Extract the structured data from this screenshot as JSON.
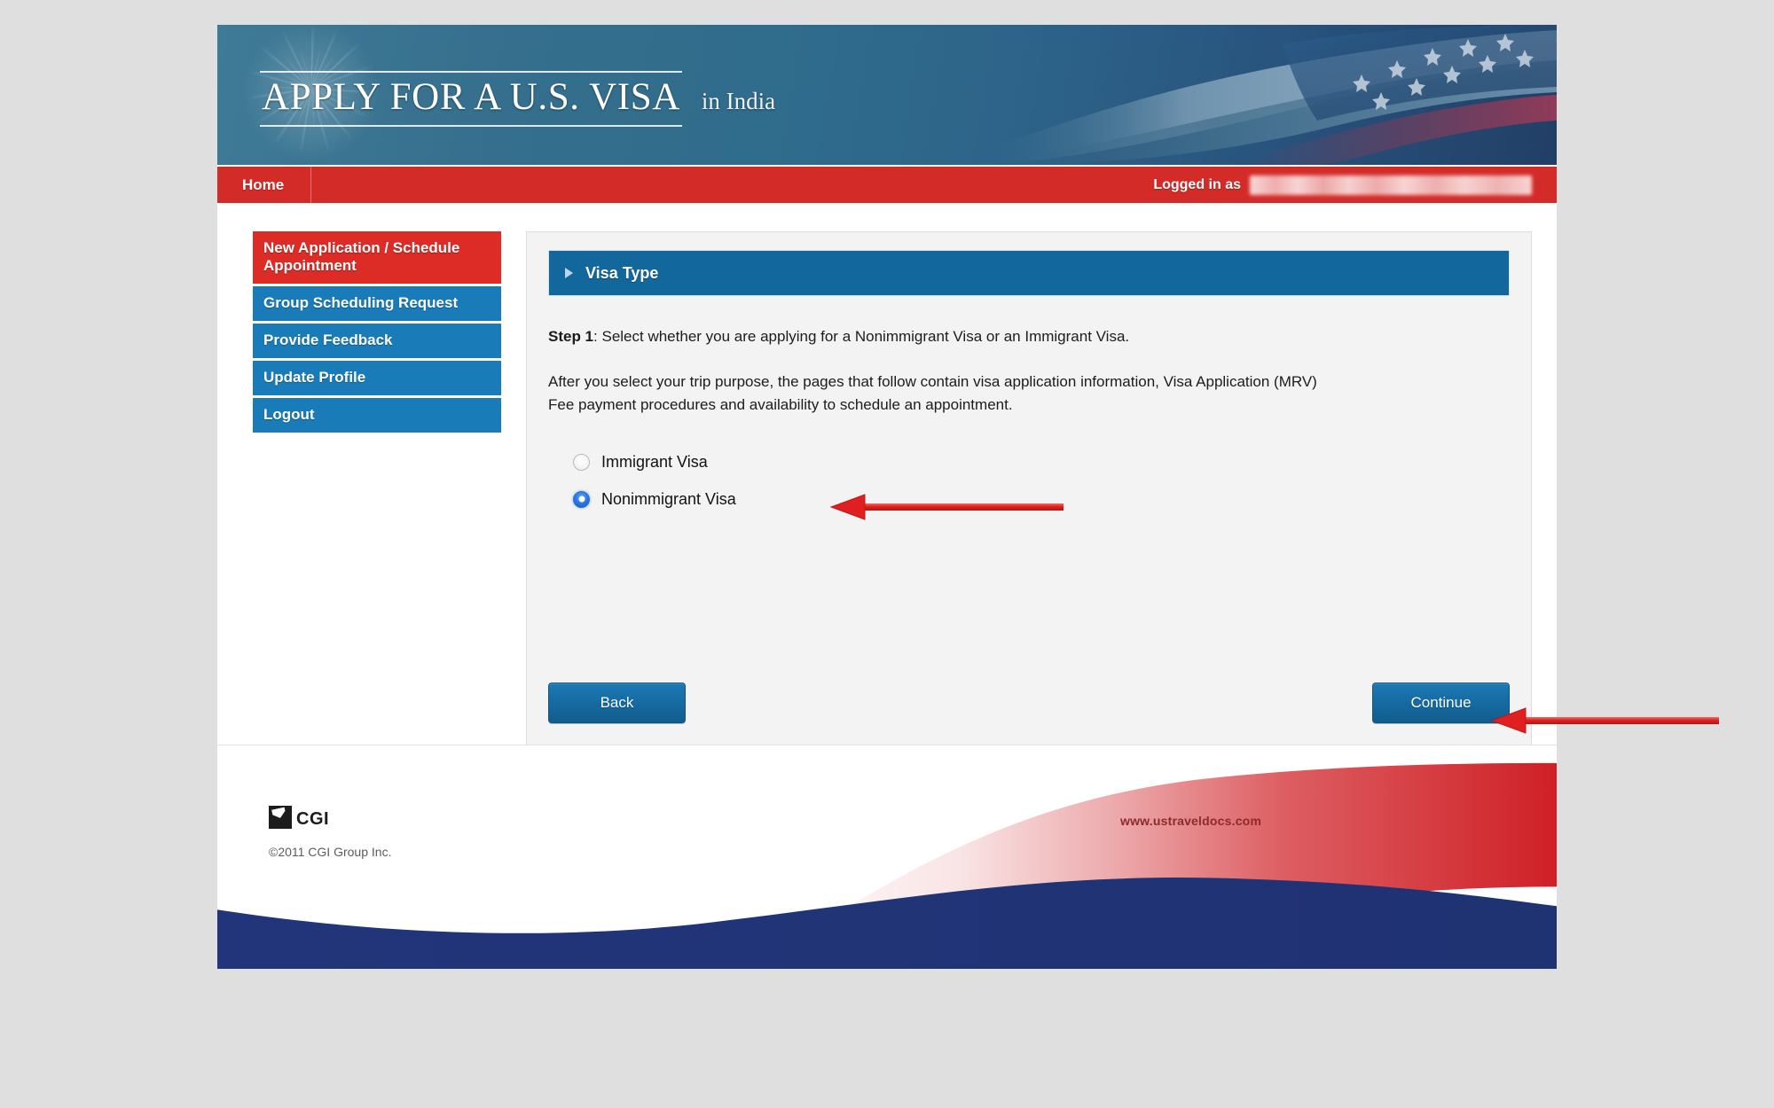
{
  "banner": {
    "title": "APPLY FOR A U.S. VISA",
    "country": "in India",
    "starburst_icon": "fireworks-burst-icon",
    "flag_icon": "us-flag-icon"
  },
  "navbar": {
    "home_label": "Home",
    "logged_in_label": "Logged in as",
    "logged_in_user": "",
    "background_color": "#d32b28"
  },
  "sidebar": {
    "items": [
      {
        "label": "New Application / Schedule Appointment",
        "state": "active",
        "color": "#dd2b26"
      },
      {
        "label": "Group Scheduling Request",
        "state": "normal",
        "color": "#1a7bb9"
      },
      {
        "label": "Provide Feedback",
        "state": "normal",
        "color": "#1a7bb9"
      },
      {
        "label": "Update Profile",
        "state": "normal",
        "color": "#1a7bb9"
      },
      {
        "label": "Logout",
        "state": "normal",
        "color": "#1a7bb9"
      }
    ]
  },
  "panel": {
    "header_title": "Visa Type",
    "header_color": "#12679c",
    "expand_icon": "triangle-right-icon",
    "step_label": "Step 1",
    "step_text": ": Select whether you are applying for a Nonimmigrant Visa or an Immigrant Visa.",
    "paragraph_line1": "After you select your trip purpose, the pages that follow contain visa application information, Visa Application (MRV)",
    "paragraph_line2": "Fee payment procedures and availability to schedule an appointment.",
    "options": [
      {
        "label": "Immigrant Visa",
        "selected": false
      },
      {
        "label": "Nonimmigrant Visa",
        "selected": true
      }
    ],
    "back_label": "Back",
    "continue_label": "Continue",
    "button_color": "#15699f"
  },
  "footer": {
    "logo_icon": "cgi-logo-icon",
    "logo_text": "CGI",
    "copyright": "©2011 CGI Group Inc.",
    "url": "www.ustraveldocs.com",
    "wave_red": "#cf2026",
    "wave_navy": "#22357a"
  },
  "annotations": [
    {
      "name": "arrow-to-nonimmigrant-radio",
      "color": "#e02020",
      "direction": "left"
    },
    {
      "name": "arrow-to-continue-button",
      "color": "#e02020",
      "direction": "left"
    }
  ]
}
